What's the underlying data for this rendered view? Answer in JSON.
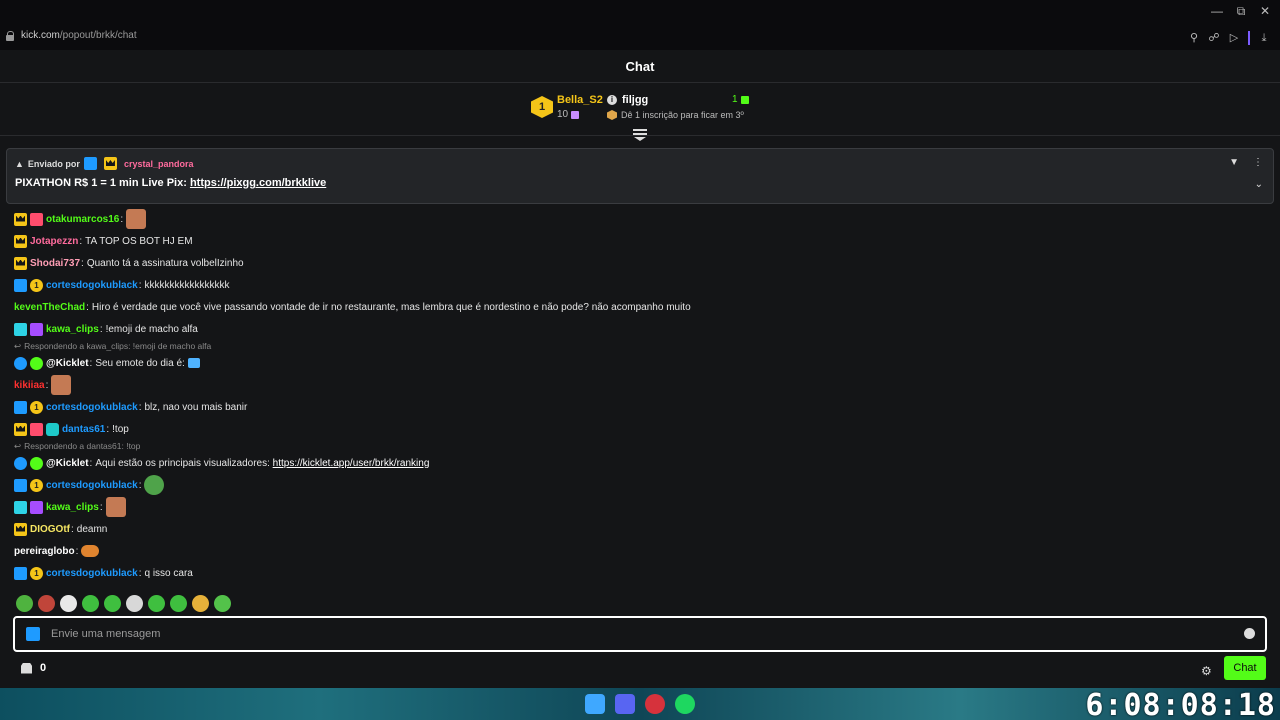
{
  "browser": {
    "url_host": "kick.com",
    "url_path": "/popout/brkk/chat"
  },
  "chat": {
    "title": "Chat",
    "leaderboard": {
      "rank1_badge": "1",
      "rank1_name": "Bella_S2",
      "rank1_count": "10",
      "rank2_name": "filjgg",
      "rank2_count": "1",
      "hint": "Dê 1 inscrição para ficar em 3º"
    },
    "pinned": {
      "sent_by": "Enviado por",
      "user": "crystal_pandora",
      "message": "PIXATHON R$ 1 = 1 min Live Pix:",
      "link": "https://pixgg.com/brkklive"
    },
    "messages": [
      {
        "user": "otakumarcos16",
        "color": "#53fc18",
        "text": ""
      },
      {
        "user": "Jotapezzn",
        "color": "#ff6b9d",
        "text": "TA TOP OS BOT HJ EM"
      },
      {
        "user": "Shodai737",
        "color": "#ff9eb5",
        "text": "Quanto tá a assinatura volbelIzinho"
      },
      {
        "user": "cortesdogokublack",
        "color": "#1e9bff",
        "text": "kkkkkkkkkkkkkkkkk"
      },
      {
        "user": "kevenTheChad",
        "color": "#53fc18",
        "text": "Hiro é verdade que você vive passando vontade de ir no restaurante, mas lembra que é nordestino e não pode? não acompanho muito"
      },
      {
        "user": "kawa_clips",
        "color": "#53fc18",
        "text": "!emoji de macho alfa"
      },
      {
        "reply": "Respondendo a kawa_clips: !emoji de macho alfa"
      },
      {
        "user": "@Kicklet",
        "color": "#ffffff",
        "text": "Seu emote do dia é:"
      },
      {
        "user": "kikiiaa",
        "color": "#ff3030",
        "text": ""
      },
      {
        "user": "cortesdogokublack",
        "color": "#1e9bff",
        "text": "blz, nao vou mais banir"
      },
      {
        "user": "dantas61",
        "color": "#1e9bff",
        "text": "!top"
      },
      {
        "reply": "Respondendo a dantas61: !top"
      },
      {
        "user": "@Kicklet",
        "color": "#ffffff",
        "text": "Aqui estão os principais visualizadores:",
        "link": "https://kicklet.app/user/brkk/ranking"
      },
      {
        "user": "cortesdogokublack",
        "color": "#1e9bff",
        "text": ""
      },
      {
        "user": "kawa_clips",
        "color": "#53fc18",
        "text": ""
      },
      {
        "user": "DIOGOtf",
        "color": "#f5e663",
        "text": "deamn"
      },
      {
        "user": "pereiraglobo",
        "color": "#ffffff",
        "text": ""
      },
      {
        "user": "cortesdogokublack",
        "color": "#1e9bff",
        "text": "q isso cara"
      }
    ],
    "composer": {
      "placeholder": "Envie uma mensagem"
    },
    "points": "0",
    "send_label": "Chat"
  },
  "taskbar": {
    "clock": "6:08:08:18"
  },
  "colors": {
    "accent": "#53fc18",
    "panel_bg": "#141517"
  }
}
